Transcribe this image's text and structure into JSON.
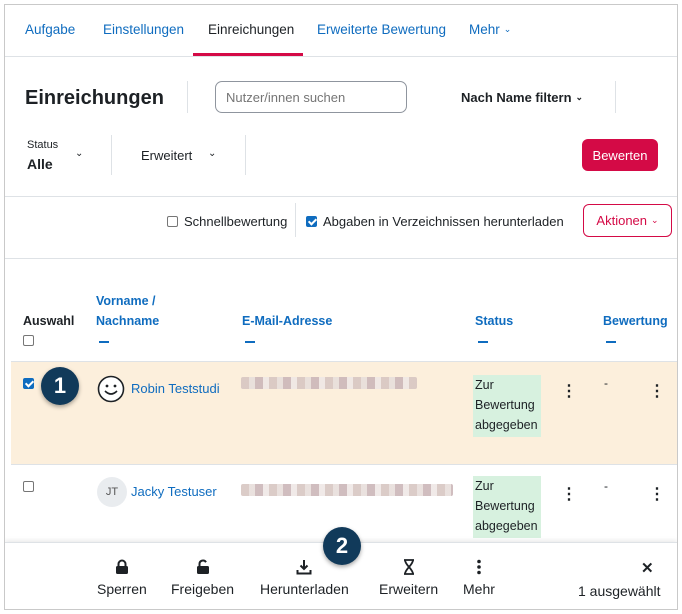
{
  "nav": {
    "items": [
      {
        "label": "Aufgabe"
      },
      {
        "label": "Einstellungen"
      },
      {
        "label": "Einreichungen"
      },
      {
        "label": "Erweiterte Bewertung"
      },
      {
        "label": "Mehr"
      }
    ],
    "active": "Einreichungen"
  },
  "header": {
    "title": "Einreichungen",
    "search_placeholder": "Nutzer/innen suchen",
    "filter_name": "Nach Name filtern"
  },
  "filters": {
    "status_label": "Status",
    "status_value": "Alle",
    "advanced": "Erweitert",
    "grade_button": "Bewerten"
  },
  "options": {
    "quick_grading": "Schnellbewertung",
    "quick_grading_checked": false,
    "download_in_folders": "Abgaben in Verzeichnissen herunterladen",
    "download_in_folders_checked": true,
    "actions_button": "Aktionen"
  },
  "table": {
    "headers": {
      "select": "Auswahl",
      "first_last_name_1": "Vorname /",
      "first_last_name_2": "Nachname",
      "email": "E-Mail-Adresse",
      "status": "Status",
      "grade": "Bewertung"
    },
    "rows": [
      {
        "name": "Robin Teststudi",
        "selected": true,
        "status_line1": "Zur",
        "status_line2": "Bewertung",
        "status_line3": "abgegeben",
        "grade": "-"
      },
      {
        "name": "Jacky Testuser",
        "initials": "JT",
        "selected": false,
        "status_line1": "Zur",
        "status_line2": "Bewertung",
        "status_line3": "abgegeben",
        "grade": "-"
      }
    ]
  },
  "markers": {
    "one": "1",
    "two": "2"
  },
  "footer": {
    "lock": "Sperren",
    "unlock": "Freigeben",
    "download": "Herunterladen",
    "extend": "Erweitern",
    "more": "Mehr",
    "selected_count": "1 ausgewählt"
  },
  "colors": {
    "brand": "#d40a46",
    "link": "#0f6cbf",
    "selected_row": "#fcefdc",
    "status_bg": "#d7f1df",
    "marker": "#113a5a"
  }
}
